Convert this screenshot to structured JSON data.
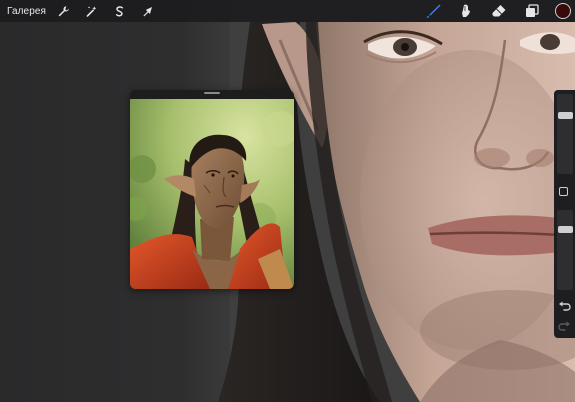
{
  "toolbar": {
    "gallery_label": "Галерея",
    "left_tools": [
      {
        "name": "actions",
        "icon": "wrench-icon"
      },
      {
        "name": "adjustments",
        "icon": "magic-wand-icon"
      },
      {
        "name": "selection",
        "icon": "selection-s-icon"
      },
      {
        "name": "transform",
        "icon": "arrow-cursor-icon"
      }
    ],
    "right_tools": [
      {
        "name": "brush",
        "icon": "brush-icon",
        "active": true
      },
      {
        "name": "smudge",
        "icon": "smudge-icon",
        "active": false
      },
      {
        "name": "eraser",
        "icon": "eraser-icon",
        "active": false
      },
      {
        "name": "layers",
        "icon": "layers-icon",
        "active": false
      }
    ],
    "current_color": "#3a0a0a",
    "active_tool_color": "#3f7ef0"
  },
  "reference_window": {
    "visible": true
  },
  "sidebar": {
    "brush_size": 0.75,
    "brush_opacity": 0.78,
    "buttons": [
      "modify-button",
      "undo-button",
      "redo-button"
    ]
  }
}
